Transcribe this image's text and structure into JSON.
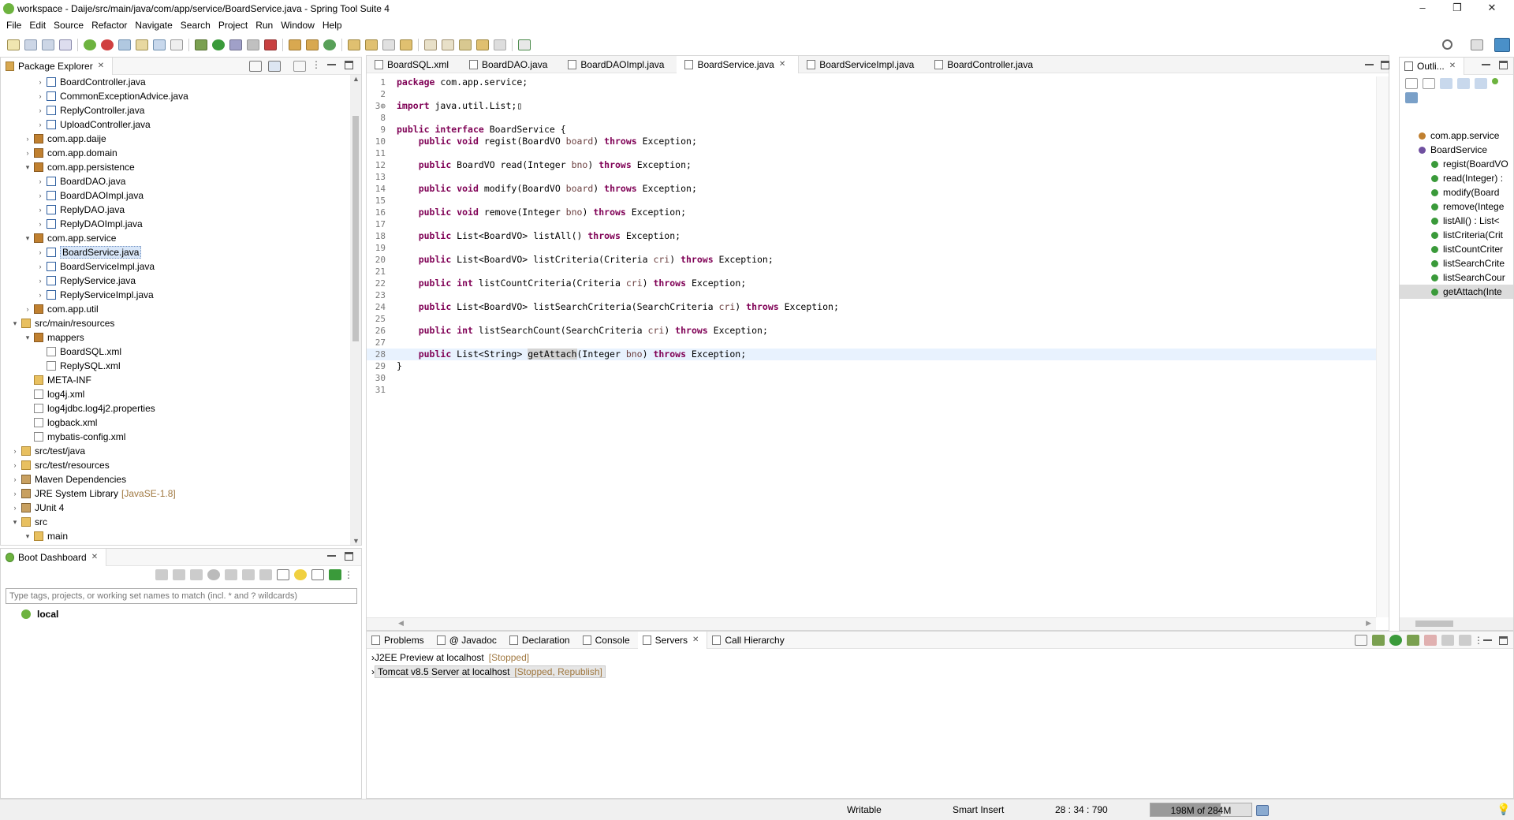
{
  "window": {
    "title": "workspace - Daije/src/main/java/com/app/service/BoardService.java - Spring Tool Suite 4",
    "controls": [
      "–",
      "❐",
      "✕"
    ]
  },
  "menu": [
    "File",
    "Edit",
    "Source",
    "Refactor",
    "Navigate",
    "Search",
    "Project",
    "Run",
    "Window",
    "Help"
  ],
  "package_explorer": {
    "title": "Package Explorer",
    "items": [
      {
        "label": "BoardController.java",
        "indent": 3,
        "arrow": "›",
        "icon": "java"
      },
      {
        "label": "CommonExceptionAdvice.java",
        "indent": 3,
        "arrow": "›",
        "icon": "java"
      },
      {
        "label": "ReplyController.java",
        "indent": 3,
        "arrow": "›",
        "icon": "java"
      },
      {
        "label": "UploadController.java",
        "indent": 3,
        "arrow": "›",
        "icon": "java"
      },
      {
        "label": "com.app.daije",
        "indent": 2,
        "arrow": "›",
        "icon": "pkg"
      },
      {
        "label": "com.app.domain",
        "indent": 2,
        "arrow": "›",
        "icon": "pkg"
      },
      {
        "label": "com.app.persistence",
        "indent": 2,
        "arrow": "⌄",
        "icon": "pkg"
      },
      {
        "label": "BoardDAO.java",
        "indent": 3,
        "arrow": "›",
        "icon": "java"
      },
      {
        "label": "BoardDAOImpl.java",
        "indent": 3,
        "arrow": "›",
        "icon": "java"
      },
      {
        "label": "ReplyDAO.java",
        "indent": 3,
        "arrow": "›",
        "icon": "java"
      },
      {
        "label": "ReplyDAOImpl.java",
        "indent": 3,
        "arrow": "›",
        "icon": "java"
      },
      {
        "label": "com.app.service",
        "indent": 2,
        "arrow": "⌄",
        "icon": "pkg"
      },
      {
        "label": "BoardService.java",
        "indent": 3,
        "arrow": "›",
        "icon": "java",
        "selected": true
      },
      {
        "label": "BoardServiceImpl.java",
        "indent": 3,
        "arrow": "›",
        "icon": "java"
      },
      {
        "label": "ReplyService.java",
        "indent": 3,
        "arrow": "›",
        "icon": "java"
      },
      {
        "label": "ReplyServiceImpl.java",
        "indent": 3,
        "arrow": "›",
        "icon": "java"
      },
      {
        "label": "com.app.util",
        "indent": 2,
        "arrow": "›",
        "icon": "pkg"
      },
      {
        "label": "src/main/resources",
        "indent": 1,
        "arrow": "⌄",
        "icon": "folder"
      },
      {
        "label": "mappers",
        "indent": 2,
        "arrow": "⌄",
        "icon": "pkg"
      },
      {
        "label": "BoardSQL.xml",
        "indent": 3,
        "arrow": "",
        "icon": "xml"
      },
      {
        "label": "ReplySQL.xml",
        "indent": 3,
        "arrow": "",
        "icon": "xml"
      },
      {
        "label": "META-INF",
        "indent": 2,
        "arrow": "",
        "icon": "folder"
      },
      {
        "label": "log4j.xml",
        "indent": 2,
        "arrow": "",
        "icon": "xml"
      },
      {
        "label": "log4jdbc.log4j2.properties",
        "indent": 2,
        "arrow": "",
        "icon": "xml"
      },
      {
        "label": "logback.xml",
        "indent": 2,
        "arrow": "",
        "icon": "xml"
      },
      {
        "label": "mybatis-config.xml",
        "indent": 2,
        "arrow": "",
        "icon": "xml"
      },
      {
        "label": "src/test/java",
        "indent": 1,
        "arrow": "›",
        "icon": "folder"
      },
      {
        "label": "src/test/resources",
        "indent": 1,
        "arrow": "›",
        "icon": "folder"
      },
      {
        "label": "Maven Dependencies",
        "indent": 1,
        "arrow": "›",
        "icon": "lib"
      },
      {
        "label": "JRE System Library",
        "dim": "[JavaSE-1.8]",
        "indent": 1,
        "arrow": "›",
        "icon": "lib"
      },
      {
        "label": "JUnit 4",
        "indent": 1,
        "arrow": "›",
        "icon": "lib"
      },
      {
        "label": "src",
        "indent": 1,
        "arrow": "⌄",
        "icon": "folder"
      },
      {
        "label": "main",
        "indent": 2,
        "arrow": "⌄",
        "icon": "folder"
      }
    ]
  },
  "boot_dashboard": {
    "title": "Boot Dashboard",
    "filter_placeholder": "Type tags, projects, or working set names to match (incl. * and ? wildcards)",
    "items": [
      "local"
    ]
  },
  "editor": {
    "tabs": [
      "BoardSQL.xml",
      "BoardDAO.java",
      "BoardDAOImpl.java",
      "BoardService.java",
      "BoardServiceImpl.java",
      "BoardController.java"
    ],
    "active_tab": "BoardService.java",
    "lines": [
      {
        "n": "1",
        "code": "package com.app.service;"
      },
      {
        "n": "2",
        "code": ""
      },
      {
        "n": "3⊕",
        "code": "import java.util.List;▯"
      },
      {
        "n": "8",
        "code": ""
      },
      {
        "n": "9",
        "code": "public interface BoardService {"
      },
      {
        "n": "10",
        "code": "    public void regist(BoardVO board) throws Exception;"
      },
      {
        "n": "11",
        "code": ""
      },
      {
        "n": "12",
        "code": "    public BoardVO read(Integer bno) throws Exception;"
      },
      {
        "n": "13",
        "code": ""
      },
      {
        "n": "14",
        "code": "    public void modify(BoardVO board) throws Exception;"
      },
      {
        "n": "15",
        "code": ""
      },
      {
        "n": "16",
        "code": "    public void remove(Integer bno) throws Exception;"
      },
      {
        "n": "17",
        "code": ""
      },
      {
        "n": "18",
        "code": "    public List<BoardVO> listAll() throws Exception;"
      },
      {
        "n": "19",
        "code": ""
      },
      {
        "n": "20",
        "code": "    public List<BoardVO> listCriteria(Criteria cri) throws Exception;"
      },
      {
        "n": "21",
        "code": ""
      },
      {
        "n": "22",
        "code": "    public int listCountCriteria(Criteria cri) throws Exception;"
      },
      {
        "n": "23",
        "code": ""
      },
      {
        "n": "24",
        "code": "    public List<BoardVO> listSearchCriteria(SearchCriteria cri) throws Exception;"
      },
      {
        "n": "25",
        "code": ""
      },
      {
        "n": "26",
        "code": "    public int listSearchCount(SearchCriteria cri) throws Exception;"
      },
      {
        "n": "27",
        "code": ""
      },
      {
        "n": "28",
        "code": "    public List<String> getAttach(Integer bno) throws Exception;",
        "current": true
      },
      {
        "n": "29",
        "code": "}"
      },
      {
        "n": "30",
        "code": ""
      },
      {
        "n": "31",
        "code": ""
      }
    ]
  },
  "outline": {
    "title": "Outli...",
    "items": [
      {
        "label": "com.app.service",
        "indent": 0
      },
      {
        "label": "BoardService",
        "indent": 0
      },
      {
        "label": "regist(BoardVO",
        "indent": 1
      },
      {
        "label": "read(Integer) :",
        "indent": 1
      },
      {
        "label": "modify(Board",
        "indent": 1
      },
      {
        "label": "remove(Intege",
        "indent": 1
      },
      {
        "label": "listAll() : List<",
        "indent": 1
      },
      {
        "label": "listCriteria(Crit",
        "indent": 1
      },
      {
        "label": "listCountCriter",
        "indent": 1
      },
      {
        "label": "listSearchCrite",
        "indent": 1
      },
      {
        "label": "listSearchCour",
        "indent": 1
      },
      {
        "label": "getAttach(Inte",
        "indent": 1,
        "selected": true
      }
    ]
  },
  "bottom": {
    "tabs": [
      "Problems",
      "@ Javadoc",
      "Declaration",
      "Console",
      "Servers",
      "Call Hierarchy"
    ],
    "active_tab": "Servers",
    "servers": [
      {
        "name": "J2EE Preview at localhost",
        "status": "[Stopped]"
      },
      {
        "name": "Tomcat v8.5 Server at localhost",
        "status": "[Stopped, Republish]",
        "selected": true
      }
    ]
  },
  "status": {
    "writable": "Writable",
    "insert_mode": "Smart Insert",
    "position": "28 : 34 : 790",
    "heap": "198M of 284M",
    "heap_used_fraction": 0.697
  },
  "colors": {
    "keyword": "#7f0055",
    "accent": "#6db33f",
    "selection": "#d8e6f8"
  }
}
